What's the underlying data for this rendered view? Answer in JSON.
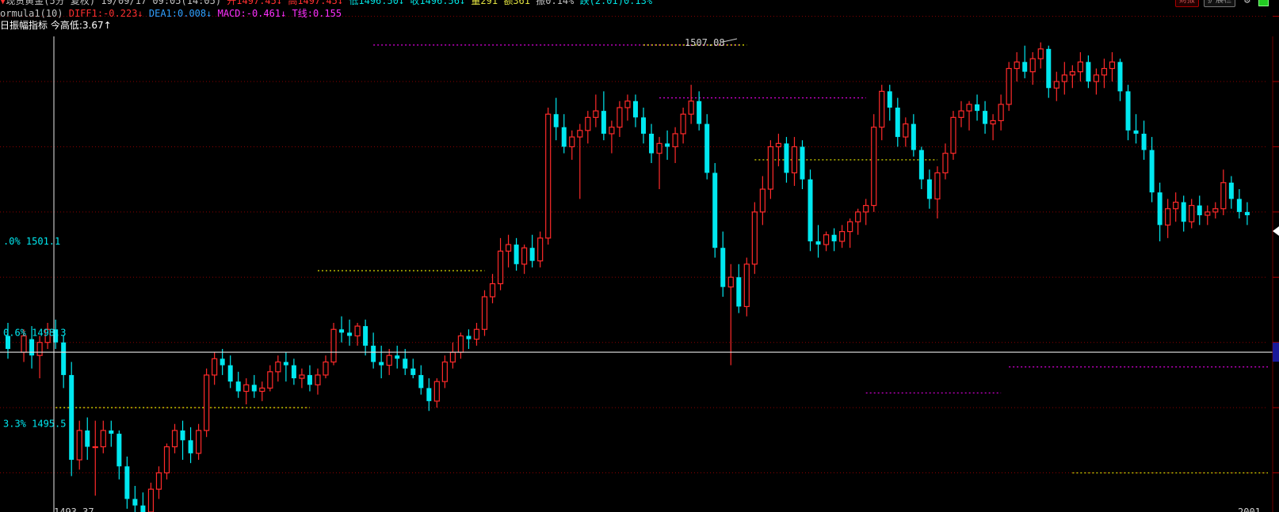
{
  "header": {
    "instrument": "现货黄金(5分 复权) 19/09/17 09:05(14:05)",
    "items": [
      {
        "text": "开1497.45↓",
        "color": "#ff3030"
      },
      {
        "text": "高1497.45↓",
        "color": "#ff3030"
      },
      {
        "text": "低1496.50↓",
        "color": "#00e0e0"
      },
      {
        "text": "收1496.56↓",
        "color": "#00e0e0"
      },
      {
        "text": "量291",
        "color": "#e0e040"
      },
      {
        "text": "额361",
        "color": "#e0e040"
      },
      {
        "text": "振0.14%",
        "color": "#c0c0c0"
      },
      {
        "text": "跌(2.01)0.13%",
        "color": "#00e0e0"
      }
    ]
  },
  "formula": {
    "name": "ormula1(10)",
    "diff": "DIFF1:-0.223↓",
    "dea": "DEA1:0.008↓",
    "macd": "MACD:-0.461↓",
    "t": "T线:0.155"
  },
  "indicator": {
    "label": "日振幅指标",
    "value": "今高低:3.67↑"
  },
  "toolbar": {
    "btn1": "财报",
    "btn2": "扩展栏",
    "settings_icon": "gear-icon",
    "status_icon": "green-status-icon"
  },
  "chart": {
    "high_label": "1507.08",
    "low_label": "1493.37",
    "right_bottom": "2001"
  },
  "left_labels": [
    {
      "id": "top",
      "text": ".0% 1501.1"
    },
    {
      "id": "mid",
      "text": "0.6% 1498.3"
    },
    {
      "id": "bot",
      "text": "3.3% 1495.5"
    }
  ],
  "chart_data": {
    "type": "candlestick",
    "title": "",
    "xlabel": "",
    "ylabel": "",
    "ylim": [
      1492.8,
      1508.5
    ],
    "grid": true,
    "crosshair_price": 1497.7,
    "labeled_levels": [
      1501.1,
      1498.3,
      1495.5
    ],
    "x_range": [
      -2,
      154
    ],
    "candles": [
      [
        -2,
        1498.2,
        1498.6,
        1497.5,
        1497.8
      ],
      [
        0,
        1497.7,
        1498.4,
        1497.4,
        1498.2
      ],
      [
        1,
        1498.1,
        1498.5,
        1497.2,
        1497.6
      ],
      [
        2,
        1497.6,
        1498.2,
        1496.9,
        1498.0
      ],
      [
        3,
        1498.0,
        1498.6,
        1497.8,
        1498.4
      ],
      [
        4,
        1498.4,
        1498.7,
        1497.8,
        1498.0
      ],
      [
        5,
        1498.0,
        1498.2,
        1496.6,
        1497.0
      ],
      [
        6,
        1497.0,
        1497.4,
        1493.9,
        1494.4
      ],
      [
        7,
        1494.4,
        1495.6,
        1494.1,
        1495.3
      ],
      [
        8,
        1495.3,
        1495.7,
        1494.4,
        1494.8
      ],
      [
        9,
        1494.8,
        1495.6,
        1493.3,
        1494.8
      ],
      [
        10,
        1494.8,
        1495.6,
        1494.6,
        1495.3
      ],
      [
        11,
        1495.3,
        1495.6,
        1494.8,
        1495.2
      ],
      [
        12,
        1495.2,
        1495.3,
        1493.8,
        1494.2
      ],
      [
        13,
        1494.2,
        1494.5,
        1492.9,
        1493.2
      ],
      [
        14,
        1493.2,
        1493.6,
        1492.5,
        1493.0
      ],
      [
        15,
        1493.0,
        1493.4,
        1492.6,
        1492.8
      ],
      [
        16,
        1492.8,
        1493.7,
        1492.7,
        1493.5
      ],
      [
        17,
        1493.5,
        1494.2,
        1493.2,
        1494.0
      ],
      [
        18,
        1494.0,
        1494.9,
        1493.8,
        1494.8
      ],
      [
        19,
        1494.8,
        1495.5,
        1494.6,
        1495.3
      ],
      [
        20,
        1495.3,
        1495.6,
        1494.4,
        1495.0
      ],
      [
        21,
        1495.0,
        1495.4,
        1494.3,
        1494.6
      ],
      [
        22,
        1494.6,
        1495.5,
        1494.4,
        1495.3
      ],
      [
        23,
        1495.3,
        1497.2,
        1495.1,
        1497.0
      ],
      [
        24,
        1497.0,
        1497.7,
        1496.7,
        1497.5
      ],
      [
        25,
        1497.5,
        1497.8,
        1497.0,
        1497.3
      ],
      [
        26,
        1497.3,
        1497.6,
        1496.6,
        1496.8
      ],
      [
        27,
        1496.8,
        1497.1,
        1496.3,
        1496.5
      ],
      [
        28,
        1496.5,
        1496.9,
        1496.1,
        1496.7
      ],
      [
        29,
        1496.7,
        1497.0,
        1496.3,
        1496.5
      ],
      [
        30,
        1496.5,
        1496.8,
        1496.2,
        1496.6
      ],
      [
        31,
        1496.6,
        1497.3,
        1496.5,
        1497.1
      ],
      [
        32,
        1497.1,
        1497.6,
        1496.8,
        1497.4
      ],
      [
        33,
        1497.4,
        1497.7,
        1496.8,
        1497.3
      ],
      [
        34,
        1497.3,
        1497.5,
        1496.7,
        1496.9
      ],
      [
        35,
        1496.9,
        1497.2,
        1496.6,
        1497.0
      ],
      [
        36,
        1497.0,
        1497.3,
        1496.5,
        1496.7
      ],
      [
        37,
        1496.7,
        1497.2,
        1496.4,
        1497.0
      ],
      [
        38,
        1497.0,
        1497.6,
        1496.9,
        1497.4
      ],
      [
        39,
        1497.4,
        1498.6,
        1497.3,
        1498.4
      ],
      [
        40,
        1498.4,
        1498.8,
        1498.0,
        1498.3
      ],
      [
        41,
        1498.3,
        1498.7,
        1497.9,
        1498.2
      ],
      [
        42,
        1498.2,
        1498.6,
        1497.9,
        1498.5
      ],
      [
        43,
        1498.5,
        1498.7,
        1497.6,
        1497.9
      ],
      [
        44,
        1497.9,
        1498.3,
        1497.2,
        1497.4
      ],
      [
        45,
        1497.4,
        1497.9,
        1496.9,
        1497.3
      ],
      [
        46,
        1497.3,
        1497.8,
        1497.0,
        1497.6
      ],
      [
        47,
        1497.6,
        1497.9,
        1497.2,
        1497.5
      ],
      [
        48,
        1497.5,
        1497.8,
        1497.0,
        1497.2
      ],
      [
        49,
        1497.2,
        1497.5,
        1496.9,
        1497.0
      ],
      [
        50,
        1497.0,
        1497.3,
        1496.4,
        1496.6
      ],
      [
        51,
        1496.6,
        1496.9,
        1495.9,
        1496.2
      ],
      [
        52,
        1496.2,
        1496.9,
        1496.0,
        1496.8
      ],
      [
        53,
        1496.8,
        1497.6,
        1496.6,
        1497.4
      ],
      [
        54,
        1497.4,
        1498.0,
        1497.2,
        1497.7
      ],
      [
        55,
        1497.7,
        1498.3,
        1497.5,
        1498.2
      ],
      [
        56,
        1498.2,
        1498.4,
        1497.8,
        1498.1
      ],
      [
        57,
        1498.1,
        1498.6,
        1497.9,
        1498.4
      ],
      [
        58,
        1498.4,
        1499.6,
        1498.2,
        1499.4
      ],
      [
        59,
        1499.4,
        1500.1,
        1499.2,
        1499.8
      ],
      [
        60,
        1499.8,
        1501.2,
        1499.6,
        1500.8
      ],
      [
        61,
        1500.8,
        1501.3,
        1500.3,
        1501.0
      ],
      [
        62,
        1501.0,
        1501.2,
        1500.2,
        1500.4
      ],
      [
        63,
        1500.4,
        1501.0,
        1500.1,
        1500.9
      ],
      [
        64,
        1500.9,
        1501.3,
        1500.3,
        1500.5
      ],
      [
        65,
        1500.5,
        1501.4,
        1500.3,
        1501.2
      ],
      [
        66,
        1501.2,
        1505.2,
        1501.0,
        1505.0
      ],
      [
        67,
        1505.0,
        1505.5,
        1504.2,
        1504.6
      ],
      [
        68,
        1504.6,
        1505.0,
        1503.8,
        1504.0
      ],
      [
        69,
        1504.0,
        1504.5,
        1503.6,
        1504.3
      ],
      [
        70,
        1504.3,
        1504.7,
        1502.4,
        1504.5
      ],
      [
        71,
        1504.5,
        1505.1,
        1504.1,
        1504.9
      ],
      [
        72,
        1504.9,
        1505.6,
        1504.6,
        1505.1
      ],
      [
        73,
        1505.1,
        1505.7,
        1504.2,
        1504.4
      ],
      [
        74,
        1504.4,
        1504.8,
        1503.8,
        1504.6
      ],
      [
        75,
        1504.6,
        1505.4,
        1504.3,
        1505.2
      ],
      [
        76,
        1505.2,
        1505.6,
        1504.8,
        1505.4
      ],
      [
        77,
        1505.4,
        1505.6,
        1504.6,
        1504.9
      ],
      [
        78,
        1504.9,
        1505.2,
        1504.1,
        1504.4
      ],
      [
        79,
        1504.4,
        1504.7,
        1503.5,
        1503.8
      ],
      [
        80,
        1503.8,
        1504.3,
        1502.7,
        1504.1
      ],
      [
        81,
        1504.1,
        1504.5,
        1503.6,
        1504.0
      ],
      [
        82,
        1504.0,
        1504.6,
        1503.5,
        1504.4
      ],
      [
        83,
        1504.4,
        1505.2,
        1504.1,
        1505.0
      ],
      [
        84,
        1505.0,
        1505.9,
        1504.7,
        1505.4
      ],
      [
        85,
        1505.4,
        1505.7,
        1504.5,
        1504.7
      ],
      [
        86,
        1504.7,
        1505.0,
        1503.0,
        1503.2
      ],
      [
        87,
        1503.2,
        1503.5,
        1500.6,
        1500.9
      ],
      [
        88,
        1500.9,
        1501.4,
        1499.4,
        1499.7
      ],
      [
        89,
        1499.7,
        1500.4,
        1497.3,
        1500.0
      ],
      [
        90,
        1500.0,
        1500.4,
        1498.9,
        1499.1
      ],
      [
        91,
        1499.1,
        1500.6,
        1498.8,
        1500.4
      ],
      [
        92,
        1500.4,
        1502.3,
        1500.1,
        1502.0
      ],
      [
        93,
        1502.0,
        1503.1,
        1501.6,
        1502.7
      ],
      [
        94,
        1502.7,
        1504.2,
        1502.4,
        1504.0
      ],
      [
        95,
        1504.0,
        1504.4,
        1503.4,
        1504.1
      ],
      [
        96,
        1504.1,
        1504.3,
        1502.9,
        1503.2
      ],
      [
        97,
        1503.2,
        1504.3,
        1502.8,
        1504.0
      ],
      [
        98,
        1504.0,
        1504.2,
        1502.7,
        1503.0
      ],
      [
        99,
        1503.0,
        1503.3,
        1500.8,
        1501.1
      ],
      [
        100,
        1501.1,
        1501.6,
        1500.6,
        1501.0
      ],
      [
        101,
        1501.0,
        1501.4,
        1500.8,
        1501.3
      ],
      [
        102,
        1501.3,
        1501.5,
        1500.8,
        1501.1
      ],
      [
        103,
        1501.1,
        1501.6,
        1500.9,
        1501.4
      ],
      [
        104,
        1501.4,
        1501.8,
        1500.9,
        1501.7
      ],
      [
        105,
        1501.7,
        1502.1,
        1501.3,
        1502.0
      ],
      [
        106,
        1502.0,
        1502.4,
        1501.6,
        1502.2
      ],
      [
        107,
        1502.2,
        1505.0,
        1502.0,
        1504.6
      ],
      [
        108,
        1504.6,
        1505.9,
        1504.2,
        1505.7
      ],
      [
        109,
        1505.7,
        1505.9,
        1504.8,
        1505.2
      ],
      [
        110,
        1505.2,
        1505.5,
        1504.0,
        1504.3
      ],
      [
        111,
        1504.3,
        1504.9,
        1504.0,
        1504.7
      ],
      [
        112,
        1504.7,
        1505.0,
        1503.7,
        1503.9
      ],
      [
        113,
        1503.9,
        1504.0,
        1502.7,
        1503.0
      ],
      [
        114,
        1503.0,
        1503.3,
        1502.1,
        1502.4
      ],
      [
        115,
        1502.4,
        1503.4,
        1501.8,
        1503.2
      ],
      [
        116,
        1503.2,
        1504.1,
        1503.0,
        1503.8
      ],
      [
        117,
        1503.8,
        1505.1,
        1503.6,
        1504.9
      ],
      [
        118,
        1504.9,
        1505.4,
        1504.6,
        1505.1
      ],
      [
        119,
        1505.1,
        1505.4,
        1504.5,
        1505.3
      ],
      [
        120,
        1505.3,
        1505.6,
        1504.8,
        1505.1
      ],
      [
        121,
        1505.1,
        1505.4,
        1504.4,
        1504.7
      ],
      [
        122,
        1504.7,
        1505.0,
        1504.2,
        1504.8
      ],
      [
        123,
        1504.8,
        1505.6,
        1504.5,
        1505.3
      ],
      [
        124,
        1505.3,
        1506.6,
        1505.1,
        1506.4
      ],
      [
        125,
        1506.4,
        1506.9,
        1506.0,
        1506.6
      ],
      [
        126,
        1506.6,
        1507.1,
        1506.1,
        1506.3
      ],
      [
        127,
        1506.3,
        1506.9,
        1505.9,
        1506.7
      ],
      [
        128,
        1506.7,
        1507.2,
        1506.4,
        1507.0
      ],
      [
        129,
        1507.0,
        1507.1,
        1505.5,
        1505.8
      ],
      [
        130,
        1505.8,
        1506.3,
        1505.4,
        1506.0
      ],
      [
        131,
        1506.0,
        1506.6,
        1505.6,
        1506.2
      ],
      [
        132,
        1506.2,
        1506.5,
        1505.8,
        1506.3
      ],
      [
        133,
        1506.3,
        1506.9,
        1506.0,
        1506.6
      ],
      [
        134,
        1506.6,
        1506.8,
        1505.8,
        1506.0
      ],
      [
        135,
        1506.0,
        1506.4,
        1505.6,
        1506.2
      ],
      [
        136,
        1506.2,
        1506.7,
        1505.8,
        1506.4
      ],
      [
        137,
        1506.4,
        1506.9,
        1506.0,
        1506.6
      ],
      [
        138,
        1506.6,
        1506.7,
        1505.4,
        1505.7
      ],
      [
        139,
        1505.7,
        1505.9,
        1504.2,
        1504.5
      ],
      [
        140,
        1504.5,
        1505.0,
        1504.1,
        1504.4
      ],
      [
        141,
        1504.4,
        1504.8,
        1503.6,
        1503.9
      ],
      [
        142,
        1503.9,
        1504.3,
        1502.3,
        1502.6
      ],
      [
        143,
        1502.6,
        1502.9,
        1501.1,
        1501.6
      ],
      [
        144,
        1501.6,
        1502.4,
        1501.2,
        1502.1
      ],
      [
        145,
        1502.1,
        1502.6,
        1501.7,
        1502.3
      ],
      [
        146,
        1502.3,
        1502.5,
        1501.4,
        1501.7
      ],
      [
        147,
        1501.7,
        1502.4,
        1501.5,
        1502.2
      ],
      [
        148,
        1502.2,
        1502.5,
        1501.6,
        1501.9
      ],
      [
        149,
        1501.9,
        1502.2,
        1501.6,
        1502.0
      ],
      [
        150,
        1502.0,
        1502.3,
        1501.8,
        1502.1
      ],
      [
        151,
        1502.1,
        1503.3,
        1501.9,
        1502.9
      ],
      [
        152,
        1502.9,
        1503.1,
        1502.1,
        1502.4
      ],
      [
        153,
        1502.4,
        1502.7,
        1501.8,
        1502.0
      ],
      [
        154,
        1502.0,
        1502.3,
        1501.6,
        1501.9
      ]
    ],
    "horizontal_levels": [
      {
        "price": 1507.12,
        "x1": 44,
        "x2": 90,
        "color": "#c000c0"
      },
      {
        "price": 1507.12,
        "x1": 78,
        "x2": 91,
        "color": "#c8c800"
      },
      {
        "price": 1505.5,
        "x1": 80,
        "x2": 106,
        "color": "#c000c0"
      },
      {
        "price": 1503.6,
        "x1": 92,
        "x2": 115,
        "color": "#c8c800"
      },
      {
        "price": 1500.2,
        "x1": 37,
        "x2": 58,
        "color": "#c8c800"
      },
      {
        "price": 1497.25,
        "x1": 124,
        "x2": 159,
        "color": "#c000c0"
      },
      {
        "price": 1496.45,
        "x1": 106,
        "x2": 123,
        "color": "#c000c0"
      },
      {
        "price": 1496.0,
        "x1": 4,
        "x2": 36,
        "color": "#c8c800"
      },
      {
        "price": 1494.0,
        "x1": 132,
        "x2": 159,
        "color": "#c8c800"
      }
    ]
  },
  "colors": {
    "background": "#000000",
    "up": "#ff2a2a",
    "down": "#00e8f0",
    "grid": "#8a0000",
    "crosshair": "#e8e8e8",
    "text": "#c0c0c0"
  }
}
